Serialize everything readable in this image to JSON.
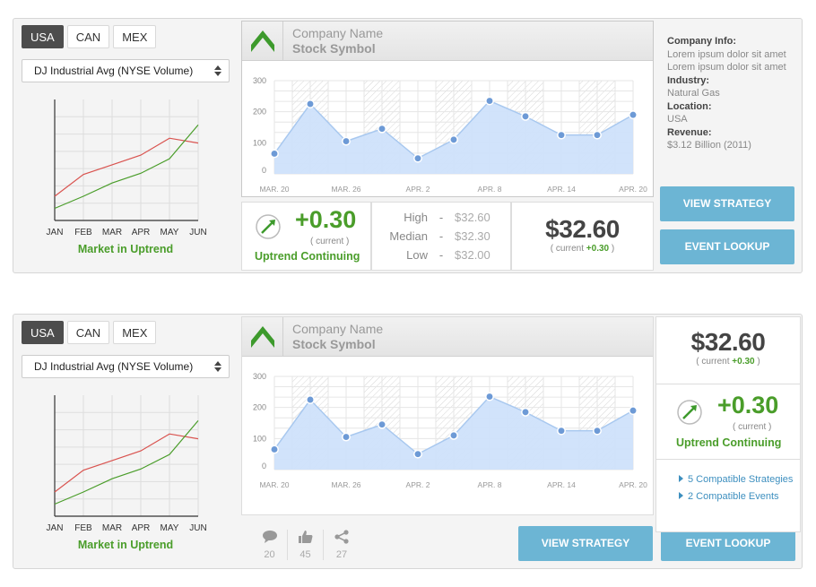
{
  "colors": {
    "accent_green": "#4a9d2a",
    "button_blue": "#6cb5d4",
    "area_fill": "#cfe2fb",
    "line_red": "#d9534f"
  },
  "widget1": {
    "tabs": [
      "USA",
      "CAN",
      "MEX"
    ],
    "active_tab": "USA",
    "select_value": "DJ Industrial Avg  (NYSE Volume)",
    "trend_label": "Market in Uptrend",
    "company_name": "Company Name",
    "stock_symbol": "Stock Symbol",
    "change": "+0.30",
    "current_label": "( current )",
    "uptrend_label": "Uptrend Continuing",
    "high_label": "High",
    "high_value": "$32.60",
    "median_label": "Median",
    "median_value": "$32.30",
    "low_label": "Low",
    "low_value": "$32.00",
    "dash": "-",
    "price": "$32.60",
    "price_current_prefix": "( current ",
    "price_current_change": "+0.30",
    "price_current_suffix": " )",
    "info": {
      "company_info_label": "Company Info:",
      "company_info_line1": "Lorem ipsum dolor sit amet",
      "company_info_line2": "Lorem ipsum dolor sit amet",
      "industry_label": "Industry:",
      "industry_value": "Natural Gas",
      "location_label": "Location:",
      "location_value": "USA",
      "revenue_label": "Revenue:",
      "revenue_value": "$3.12 Billion (2011)"
    },
    "view_strategy": "VIEW STRATEGY",
    "event_lookup": "EVENT LOOKUP"
  },
  "widget2": {
    "tabs": [
      "USA",
      "CAN",
      "MEX"
    ],
    "active_tab": "USA",
    "select_value": "DJ Industrial Avg  (NYSE Volume)",
    "trend_label": "Market in Uptrend",
    "company_name": "Company Name",
    "stock_symbol": "Stock Symbol",
    "price": "$32.60",
    "price_current_prefix": "( current ",
    "price_current_change": "+0.30",
    "price_current_suffix": " )",
    "change": "+0.30",
    "current_label": "( current )",
    "uptrend_label": "Uptrend Continuing",
    "compatible_strategies": "5 Compatible Strategies",
    "compatible_events": "2 Compatible Events",
    "comments_count": "20",
    "likes_count": "45",
    "shares_count": "27",
    "view_strategy": "VIEW STRATEGY",
    "event_lookup": "EVENT LOOKUP"
  },
  "chart_data": [
    {
      "type": "line",
      "title": "",
      "x": [
        "JAN",
        "FEB",
        "MAR",
        "APR",
        "MAY",
        "JUN"
      ],
      "series": [
        {
          "color": "#d9534f",
          "values": [
            2.0,
            3.8,
            4.6,
            5.4,
            6.8,
            6.4
          ]
        },
        {
          "color": "#4a9d2a",
          "values": [
            1.0,
            2.0,
            3.1,
            3.9,
            5.1,
            7.9
          ]
        }
      ],
      "grid": true
    },
    {
      "type": "area",
      "title": "",
      "x_ticks": [
        "MAR. 20",
        "MAR. 26",
        "APR. 2",
        "APR. 8",
        "APR. 14",
        "APR. 20"
      ],
      "y_ticks": [
        0,
        100,
        200,
        300
      ],
      "ylim": [
        0,
        300
      ],
      "values": [
        65,
        225,
        105,
        145,
        50,
        110,
        235,
        185,
        125,
        125,
        190
      ],
      "grid": true
    }
  ]
}
